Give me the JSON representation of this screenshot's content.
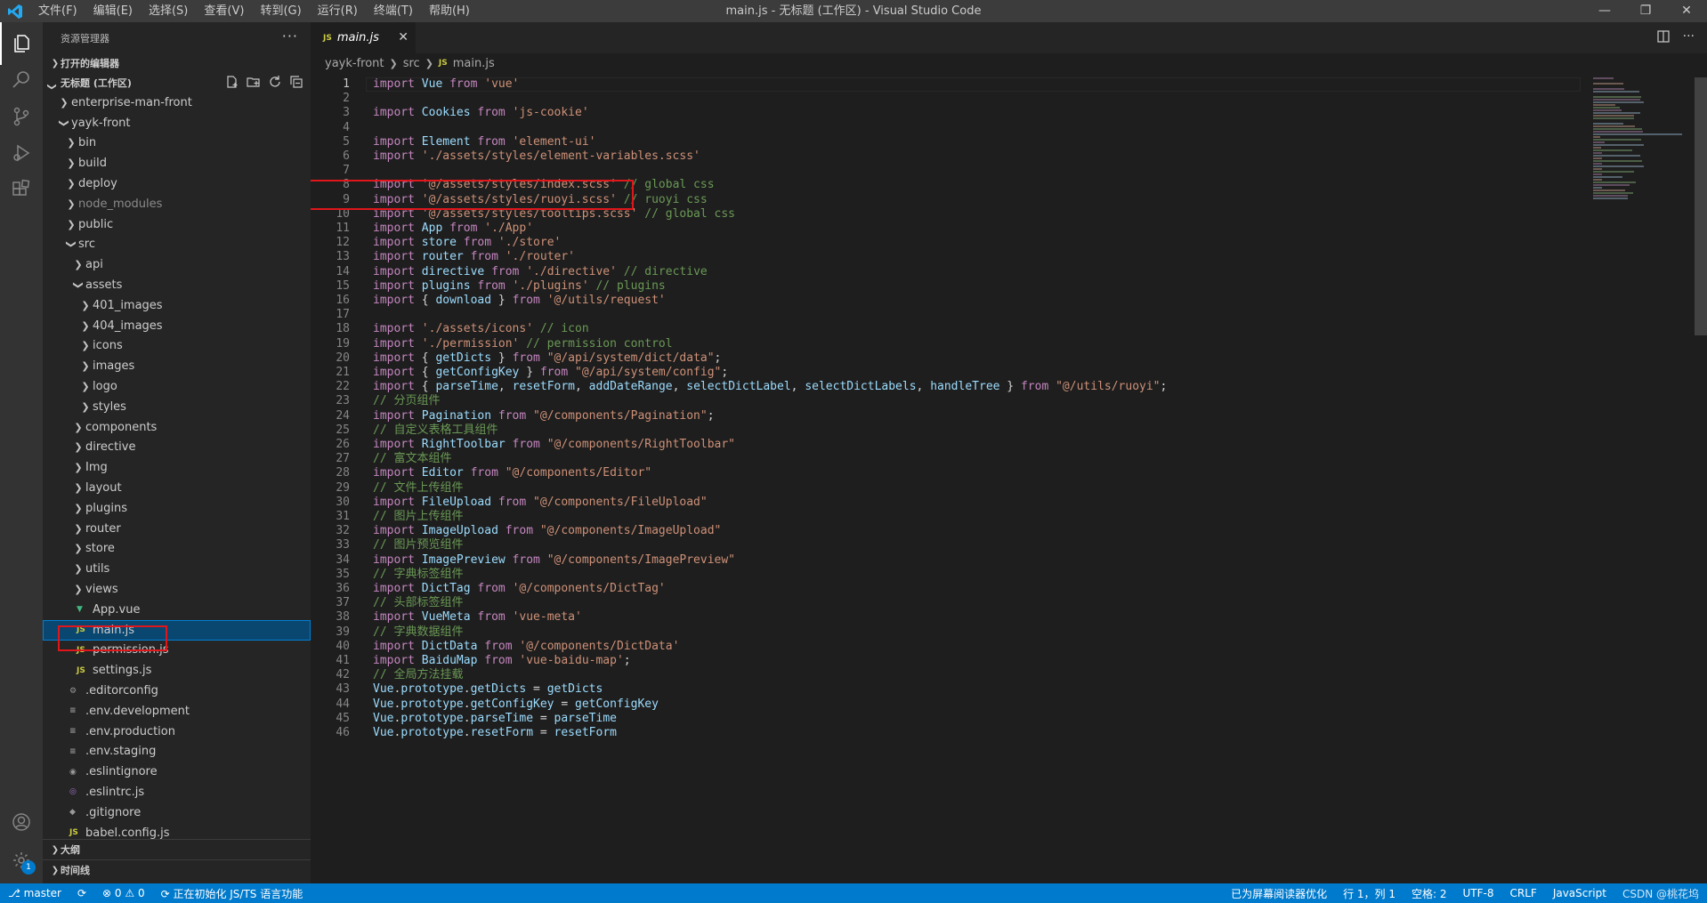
{
  "titlebar": {
    "menus": [
      "文件(F)",
      "编辑(E)",
      "选择(S)",
      "查看(V)",
      "转到(G)",
      "运行(R)",
      "终端(T)",
      "帮助(H)"
    ],
    "window_title": "main.js - 无标题 (工作区) - Visual Studio Code",
    "controls": [
      "—",
      "❐",
      "✕"
    ]
  },
  "sidebar": {
    "title": "资源管理器",
    "more": "···",
    "open_editors": "打开的编辑器",
    "workspace": "无标题 (工作区)",
    "tree": [
      {
        "label": "enterprise-man-front",
        "type": "folder",
        "open": false,
        "depth": 1
      },
      {
        "label": "yayk-front",
        "type": "folder",
        "open": true,
        "depth": 1
      },
      {
        "label": "bin",
        "type": "folder",
        "open": false,
        "depth": 2
      },
      {
        "label": "build",
        "type": "folder",
        "open": false,
        "depth": 2
      },
      {
        "label": "deploy",
        "type": "folder",
        "open": false,
        "depth": 2
      },
      {
        "label": "node_modules",
        "type": "folder",
        "open": false,
        "depth": 2,
        "dim": true
      },
      {
        "label": "public",
        "type": "folder",
        "open": false,
        "depth": 2
      },
      {
        "label": "src",
        "type": "folder",
        "open": true,
        "depth": 2
      },
      {
        "label": "api",
        "type": "folder",
        "open": false,
        "depth": 3
      },
      {
        "label": "assets",
        "type": "folder",
        "open": true,
        "depth": 3
      },
      {
        "label": "401_images",
        "type": "folder",
        "open": false,
        "depth": 4
      },
      {
        "label": "404_images",
        "type": "folder",
        "open": false,
        "depth": 4
      },
      {
        "label": "icons",
        "type": "folder",
        "open": false,
        "depth": 4
      },
      {
        "label": "images",
        "type": "folder",
        "open": false,
        "depth": 4
      },
      {
        "label": "logo",
        "type": "folder",
        "open": false,
        "depth": 4
      },
      {
        "label": "styles",
        "type": "folder",
        "open": false,
        "depth": 4
      },
      {
        "label": "components",
        "type": "folder",
        "open": false,
        "depth": 3
      },
      {
        "label": "directive",
        "type": "folder",
        "open": false,
        "depth": 3
      },
      {
        "label": "Img",
        "type": "folder",
        "open": false,
        "depth": 3
      },
      {
        "label": "layout",
        "type": "folder",
        "open": false,
        "depth": 3
      },
      {
        "label": "plugins",
        "type": "folder",
        "open": false,
        "depth": 3
      },
      {
        "label": "router",
        "type": "folder",
        "open": false,
        "depth": 3
      },
      {
        "label": "store",
        "type": "folder",
        "open": false,
        "depth": 3
      },
      {
        "label": "utils",
        "type": "folder",
        "open": false,
        "depth": 3
      },
      {
        "label": "views",
        "type": "folder",
        "open": false,
        "depth": 3
      },
      {
        "label": "App.vue",
        "type": "vue",
        "depth": 3
      },
      {
        "label": "main.js",
        "type": "js",
        "depth": 3,
        "selected": true
      },
      {
        "label": "permission.js",
        "type": "js",
        "depth": 3
      },
      {
        "label": "settings.js",
        "type": "js",
        "depth": 3
      },
      {
        "label": ".editorconfig",
        "type": "gear",
        "depth": 2
      },
      {
        "label": ".env.development",
        "type": "cfg",
        "depth": 2
      },
      {
        "label": ".env.production",
        "type": "cfg",
        "depth": 2
      },
      {
        "label": ".env.staging",
        "type": "cfg",
        "depth": 2
      },
      {
        "label": ".eslintignore",
        "type": "eslint-ignore",
        "depth": 2
      },
      {
        "label": ".eslintrc.js",
        "type": "eslint",
        "depth": 2
      },
      {
        "label": ".gitignore",
        "type": "git",
        "depth": 2
      },
      {
        "label": "babel.config.js",
        "type": "js",
        "depth": 2
      }
    ],
    "outline": "大纲",
    "timeline": "时间线"
  },
  "tabs": {
    "active_label": "main.js",
    "file_badge": "JS",
    "close": "✕"
  },
  "breadcrumb": {
    "parts": [
      "yayk-front",
      "src",
      "main.js"
    ]
  },
  "editor": {
    "lines": [
      [
        [
          "kw",
          "import"
        ],
        [
          "pl",
          " "
        ],
        [
          "var",
          "Vue"
        ],
        [
          "pl",
          " "
        ],
        [
          "kw",
          "from"
        ],
        [
          "pl",
          " "
        ],
        [
          "str",
          "'vue'"
        ]
      ],
      [],
      [
        [
          "kw",
          "import"
        ],
        [
          "pl",
          " "
        ],
        [
          "var",
          "Cookies"
        ],
        [
          "pl",
          " "
        ],
        [
          "kw",
          "from"
        ],
        [
          "pl",
          " "
        ],
        [
          "str",
          "'js-cookie'"
        ]
      ],
      [],
      [
        [
          "kw",
          "import"
        ],
        [
          "pl",
          " "
        ],
        [
          "var",
          "Element"
        ],
        [
          "pl",
          " "
        ],
        [
          "kw",
          "from"
        ],
        [
          "pl",
          " "
        ],
        [
          "str",
          "'element-ui'"
        ]
      ],
      [
        [
          "kw",
          "import"
        ],
        [
          "pl",
          " "
        ],
        [
          "str",
          "'./assets/styles/element-variables.scss'"
        ]
      ],
      [],
      [
        [
          "kw",
          "import"
        ],
        [
          "pl",
          " "
        ],
        [
          "str",
          "'@/assets/styles/index.scss'"
        ],
        [
          "pl",
          " "
        ],
        [
          "cmt",
          "// global css"
        ]
      ],
      [
        [
          "kw",
          "import"
        ],
        [
          "pl",
          " "
        ],
        [
          "str",
          "'@/assets/styles/ruoyi.scss'"
        ],
        [
          "pl",
          " "
        ],
        [
          "cmt",
          "// ruoyi css"
        ]
      ],
      [
        [
          "kw",
          "import"
        ],
        [
          "pl",
          " "
        ],
        [
          "str",
          "'@/assets/styles/tooltips.scss'"
        ],
        [
          "pl",
          " "
        ],
        [
          "cmt",
          "// global css"
        ]
      ],
      [
        [
          "kw",
          "import"
        ],
        [
          "pl",
          " "
        ],
        [
          "var",
          "App"
        ],
        [
          "pl",
          " "
        ],
        [
          "kw",
          "from"
        ],
        [
          "pl",
          " "
        ],
        [
          "str",
          "'./App'"
        ]
      ],
      [
        [
          "kw",
          "import"
        ],
        [
          "pl",
          " "
        ],
        [
          "var",
          "store"
        ],
        [
          "pl",
          " "
        ],
        [
          "kw",
          "from"
        ],
        [
          "pl",
          " "
        ],
        [
          "str",
          "'./store'"
        ]
      ],
      [
        [
          "kw",
          "import"
        ],
        [
          "pl",
          " "
        ],
        [
          "var",
          "router"
        ],
        [
          "pl",
          " "
        ],
        [
          "kw",
          "from"
        ],
        [
          "pl",
          " "
        ],
        [
          "str",
          "'./router'"
        ]
      ],
      [
        [
          "kw",
          "import"
        ],
        [
          "pl",
          " "
        ],
        [
          "var",
          "directive"
        ],
        [
          "pl",
          " "
        ],
        [
          "kw",
          "from"
        ],
        [
          "pl",
          " "
        ],
        [
          "str",
          "'./directive'"
        ],
        [
          "pl",
          " "
        ],
        [
          "cmt",
          "// directive"
        ]
      ],
      [
        [
          "kw",
          "import"
        ],
        [
          "pl",
          " "
        ],
        [
          "var",
          "plugins"
        ],
        [
          "pl",
          " "
        ],
        [
          "kw",
          "from"
        ],
        [
          "pl",
          " "
        ],
        [
          "str",
          "'./plugins'"
        ],
        [
          "pl",
          " "
        ],
        [
          "cmt",
          "// plugins"
        ]
      ],
      [
        [
          "kw",
          "import"
        ],
        [
          "pl",
          " { "
        ],
        [
          "var",
          "download"
        ],
        [
          "pl",
          " } "
        ],
        [
          "kw",
          "from"
        ],
        [
          "pl",
          " "
        ],
        [
          "str",
          "'@/utils/request'"
        ]
      ],
      [],
      [
        [
          "kw",
          "import"
        ],
        [
          "pl",
          " "
        ],
        [
          "str",
          "'./assets/icons'"
        ],
        [
          "pl",
          " "
        ],
        [
          "cmt",
          "// icon"
        ]
      ],
      [
        [
          "kw",
          "import"
        ],
        [
          "pl",
          " "
        ],
        [
          "str",
          "'./permission'"
        ],
        [
          "pl",
          " "
        ],
        [
          "cmt",
          "// permission control"
        ]
      ],
      [
        [
          "kw",
          "import"
        ],
        [
          "pl",
          " { "
        ],
        [
          "var",
          "getDicts"
        ],
        [
          "pl",
          " } "
        ],
        [
          "kw",
          "from"
        ],
        [
          "pl",
          " "
        ],
        [
          "str",
          "\"@/api/system/dict/data\""
        ],
        [
          "pl",
          ";"
        ]
      ],
      [
        [
          "kw",
          "import"
        ],
        [
          "pl",
          " { "
        ],
        [
          "var",
          "getConfigKey"
        ],
        [
          "pl",
          " } "
        ],
        [
          "kw",
          "from"
        ],
        [
          "pl",
          " "
        ],
        [
          "str",
          "\"@/api/system/config\""
        ],
        [
          "pl",
          ";"
        ]
      ],
      [
        [
          "kw",
          "import"
        ],
        [
          "pl",
          " { "
        ],
        [
          "var",
          "parseTime"
        ],
        [
          "pl",
          ", "
        ],
        [
          "var",
          "resetForm"
        ],
        [
          "pl",
          ", "
        ],
        [
          "var",
          "addDateRange"
        ],
        [
          "pl",
          ", "
        ],
        [
          "var",
          "selectDictLabel"
        ],
        [
          "pl",
          ", "
        ],
        [
          "var",
          "selectDictLabels"
        ],
        [
          "pl",
          ", "
        ],
        [
          "var",
          "handleTree"
        ],
        [
          "pl",
          " } "
        ],
        [
          "kw",
          "from"
        ],
        [
          "pl",
          " "
        ],
        [
          "str",
          "\"@/utils/ruoyi\""
        ],
        [
          "pl",
          ";"
        ]
      ],
      [
        [
          "cmt",
          "// 分页组件"
        ]
      ],
      [
        [
          "kw",
          "import"
        ],
        [
          "pl",
          " "
        ],
        [
          "var",
          "Pagination"
        ],
        [
          "pl",
          " "
        ],
        [
          "kw",
          "from"
        ],
        [
          "pl",
          " "
        ],
        [
          "str",
          "\"@/components/Pagination\""
        ],
        [
          "pl",
          ";"
        ]
      ],
      [
        [
          "cmt",
          "// 自定义表格工具组件"
        ]
      ],
      [
        [
          "kw",
          "import"
        ],
        [
          "pl",
          " "
        ],
        [
          "var",
          "RightToolbar"
        ],
        [
          "pl",
          " "
        ],
        [
          "kw",
          "from"
        ],
        [
          "pl",
          " "
        ],
        [
          "str",
          "\"@/components/RightToolbar\""
        ]
      ],
      [
        [
          "cmt",
          "// 富文本组件"
        ]
      ],
      [
        [
          "kw",
          "import"
        ],
        [
          "pl",
          " "
        ],
        [
          "var",
          "Editor"
        ],
        [
          "pl",
          " "
        ],
        [
          "kw",
          "from"
        ],
        [
          "pl",
          " "
        ],
        [
          "str",
          "\"@/components/Editor\""
        ]
      ],
      [
        [
          "cmt",
          "// 文件上传组件"
        ]
      ],
      [
        [
          "kw",
          "import"
        ],
        [
          "pl",
          " "
        ],
        [
          "var",
          "FileUpload"
        ],
        [
          "pl",
          " "
        ],
        [
          "kw",
          "from"
        ],
        [
          "pl",
          " "
        ],
        [
          "str",
          "\"@/components/FileUpload\""
        ]
      ],
      [
        [
          "cmt",
          "// 图片上传组件"
        ]
      ],
      [
        [
          "kw",
          "import"
        ],
        [
          "pl",
          " "
        ],
        [
          "var",
          "ImageUpload"
        ],
        [
          "pl",
          " "
        ],
        [
          "kw",
          "from"
        ],
        [
          "pl",
          " "
        ],
        [
          "str",
          "\"@/components/ImageUpload\""
        ]
      ],
      [
        [
          "cmt",
          "// 图片预览组件"
        ]
      ],
      [
        [
          "kw",
          "import"
        ],
        [
          "pl",
          " "
        ],
        [
          "var",
          "ImagePreview"
        ],
        [
          "pl",
          " "
        ],
        [
          "kw",
          "from"
        ],
        [
          "pl",
          " "
        ],
        [
          "str",
          "\"@/components/ImagePreview\""
        ]
      ],
      [
        [
          "cmt",
          "// 字典标签组件"
        ]
      ],
      [
        [
          "kw",
          "import"
        ],
        [
          "pl",
          " "
        ],
        [
          "var",
          "DictTag"
        ],
        [
          "pl",
          " "
        ],
        [
          "kw",
          "from"
        ],
        [
          "pl",
          " "
        ],
        [
          "str",
          "'@/components/DictTag'"
        ]
      ],
      [
        [
          "cmt",
          "// 头部标签组件"
        ]
      ],
      [
        [
          "kw",
          "import"
        ],
        [
          "pl",
          " "
        ],
        [
          "var",
          "VueMeta"
        ],
        [
          "pl",
          " "
        ],
        [
          "kw",
          "from"
        ],
        [
          "pl",
          " "
        ],
        [
          "str",
          "'vue-meta'"
        ]
      ],
      [
        [
          "cmt",
          "// 字典数据组件"
        ]
      ],
      [
        [
          "kw",
          "import"
        ],
        [
          "pl",
          " "
        ],
        [
          "var",
          "DictData"
        ],
        [
          "pl",
          " "
        ],
        [
          "kw",
          "from"
        ],
        [
          "pl",
          " "
        ],
        [
          "str",
          "'@/components/DictData'"
        ]
      ],
      [
        [
          "kw",
          "import"
        ],
        [
          "pl",
          " "
        ],
        [
          "var",
          "BaiduMap"
        ],
        [
          "pl",
          " "
        ],
        [
          "kw",
          "from"
        ],
        [
          "pl",
          " "
        ],
        [
          "str",
          "'vue-baidu-map'"
        ],
        [
          "pl",
          ";"
        ]
      ],
      [
        [
          "cmt",
          "// 全局方法挂载"
        ]
      ],
      [
        [
          "var",
          "Vue"
        ],
        [
          "pl",
          "."
        ],
        [
          "var",
          "prototype"
        ],
        [
          "pl",
          "."
        ],
        [
          "var",
          "getDicts"
        ],
        [
          "pl",
          " = "
        ],
        [
          "var",
          "getDicts"
        ]
      ],
      [
        [
          "var",
          "Vue"
        ],
        [
          "pl",
          "."
        ],
        [
          "var",
          "prototype"
        ],
        [
          "pl",
          "."
        ],
        [
          "var",
          "getConfigKey"
        ],
        [
          "pl",
          " = "
        ],
        [
          "var",
          "getConfigKey"
        ]
      ],
      [
        [
          "var",
          "Vue"
        ],
        [
          "pl",
          "."
        ],
        [
          "var",
          "prototype"
        ],
        [
          "pl",
          "."
        ],
        [
          "var",
          "parseTime"
        ],
        [
          "pl",
          " = "
        ],
        [
          "var",
          "parseTime"
        ]
      ],
      [
        [
          "var",
          "Vue"
        ],
        [
          "pl",
          "."
        ],
        [
          "var",
          "prototype"
        ],
        [
          "pl",
          "."
        ],
        [
          "var",
          "resetForm"
        ],
        [
          "pl",
          " = "
        ],
        [
          "var",
          "resetForm"
        ]
      ]
    ]
  },
  "statusbar": {
    "branch": "master",
    "sync": "⟳",
    "problems": "⊗ 0 ⚠ 0",
    "init_msg": "正在初始化 JS/TS 语言功能",
    "screen_reader": "已为屏幕阅读器优化",
    "position": "行 1，列 1",
    "spaces": "空格: 2",
    "encoding": "UTF-8",
    "eol": "CRLF",
    "language": "JavaScript",
    "watermark": "CSDN @桃花坞"
  },
  "activity": {
    "badge": "1"
  }
}
